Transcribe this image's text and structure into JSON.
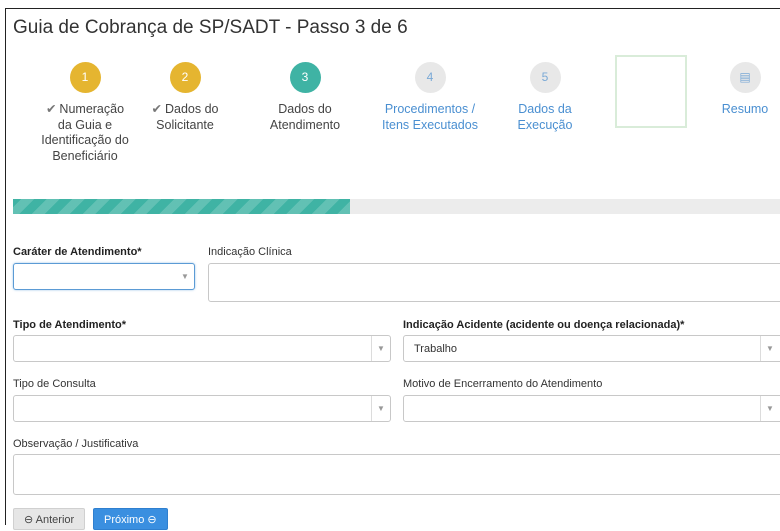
{
  "page": {
    "title": "Guia de Cobrança de SP/SADT - Passo 3 de 6"
  },
  "steps": [
    {
      "number": "1",
      "label_lines": [
        "Numeração",
        "da Guia e",
        "Identificação do",
        "Beneficiário"
      ],
      "status": "done",
      "check": "✔"
    },
    {
      "number": "2",
      "label_lines": [
        "Dados do",
        "Solicitante"
      ],
      "status": "done",
      "check": "✔"
    },
    {
      "number": "3",
      "label_lines": [
        "Dados do",
        "Atendimento"
      ],
      "status": "active"
    },
    {
      "number": "4",
      "label_lines": [
        "Procedimentos /",
        "Itens Executados"
      ],
      "status": "todo"
    },
    {
      "number": "5",
      "label_lines": [
        "Dados da",
        "Execução"
      ],
      "status": "todo"
    },
    {
      "number": "",
      "label_lines": [
        "Resumo"
      ],
      "status": "todo",
      "icon": "document-icon"
    }
  ],
  "progress": {
    "percent": 44,
    "color": "#3fb3a4"
  },
  "form": {
    "carater_label": "Caráter de Atendimento*",
    "carater_value": "",
    "indicacao_clinica_label": "Indicação Clínica",
    "indicacao_clinica_value": "",
    "tipo_atendimento_label": "Tipo de Atendimento*",
    "tipo_atendimento_value": "",
    "indicacao_acidente_label": "Indicação Acidente (acidente ou doença relacionada)*",
    "indicacao_acidente_value": "Trabalho",
    "tipo_consulta_label": "Tipo de Consulta",
    "tipo_consulta_value": "",
    "motivo_encerramento_label": "Motivo de Encerramento do Atendimento",
    "motivo_encerramento_value": "",
    "observacao_label": "Observação / Justificativa",
    "observacao_value": ""
  },
  "buttons": {
    "anterior_label": "Anterior",
    "anterior_icon": "⊖",
    "proximo_label": "Próximo",
    "proximo_icon": "⊖"
  },
  "icons": {
    "caret": "▼",
    "document": "▤"
  }
}
